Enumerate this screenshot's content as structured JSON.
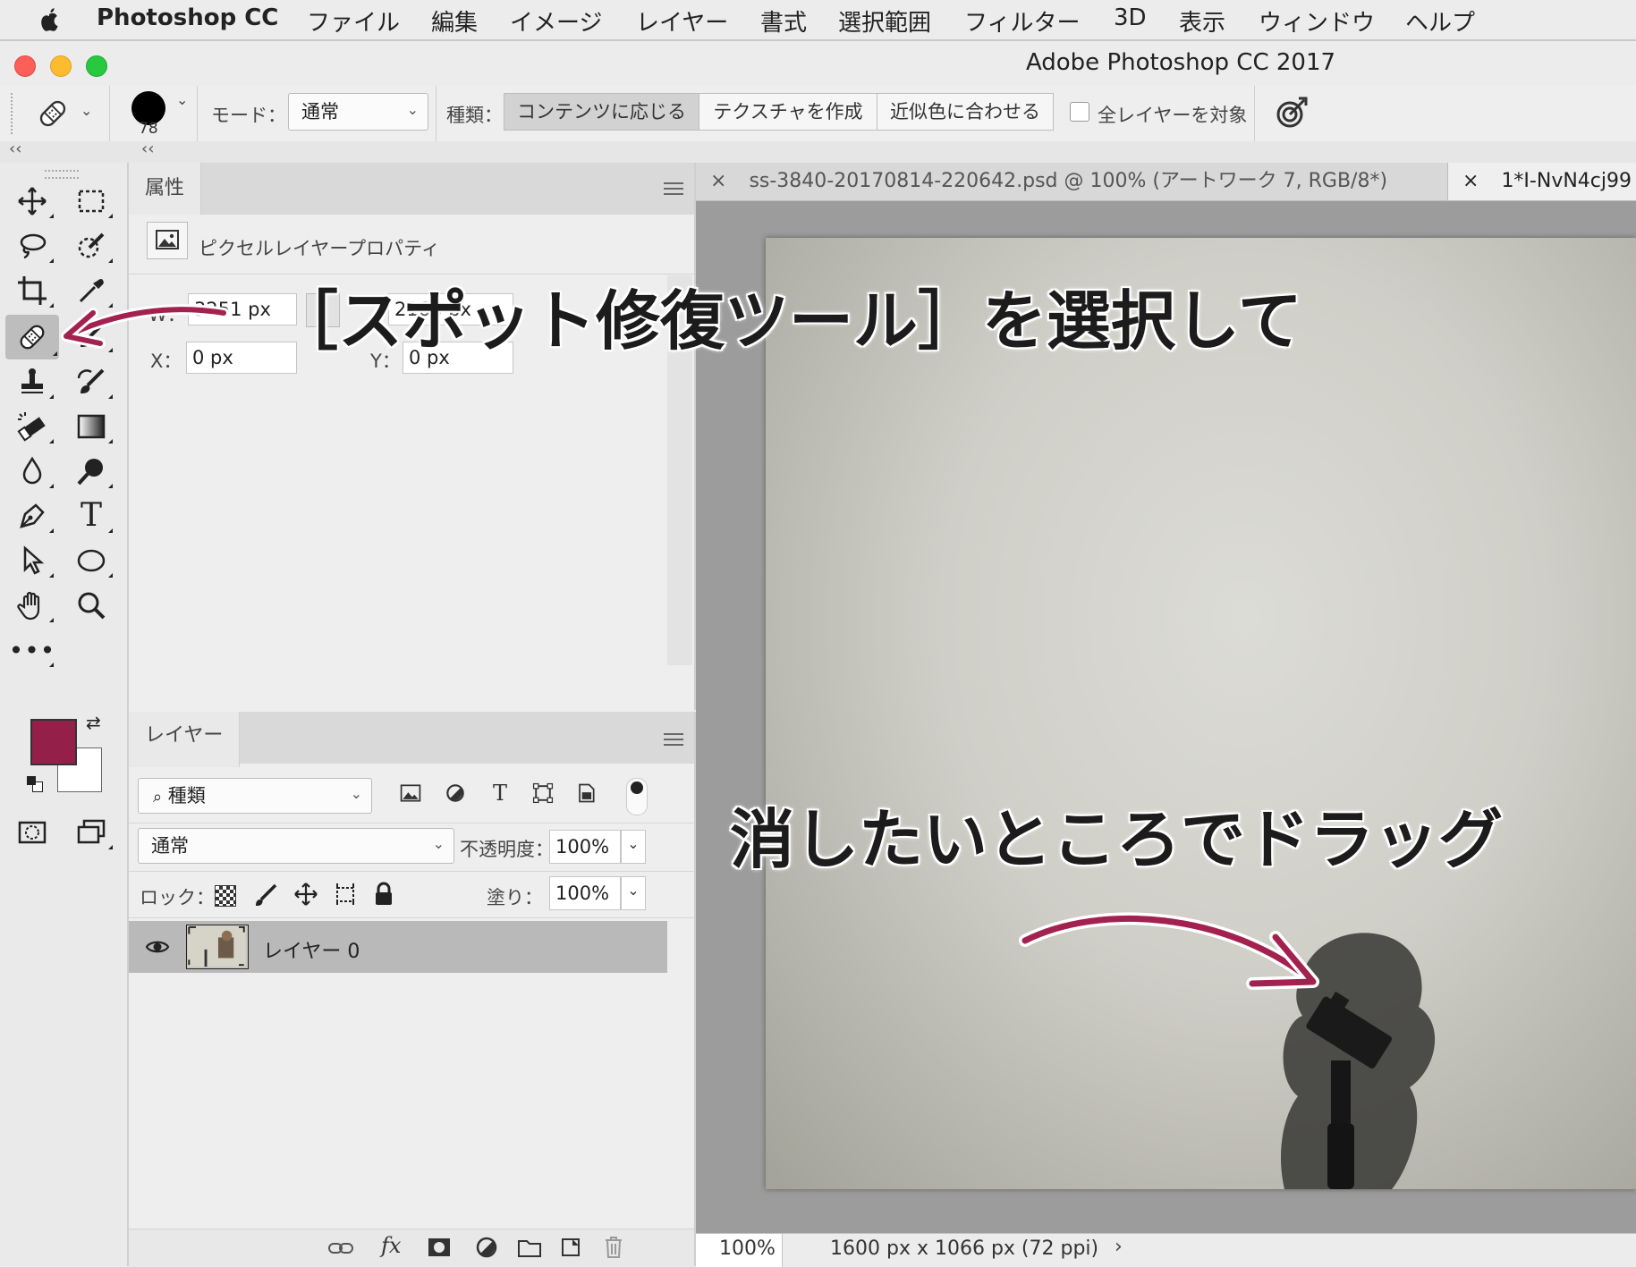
{
  "menubar": {
    "app_name": "Photoshop CC",
    "items": [
      "ファイル",
      "編集",
      "イメージ",
      "レイヤー",
      "書式",
      "選択範囲",
      "フィルター",
      "3D",
      "表示",
      "ウィンドウ",
      "ヘルプ"
    ]
  },
  "window": {
    "title": "Adobe Photoshop CC 2017"
  },
  "options": {
    "brush_size": "78",
    "mode_label": "モード：",
    "mode_value": "通常",
    "type_label": "種類：",
    "type_options": [
      "コンテンツに応じる",
      "テクスチャを作成",
      "近似色に合わせる"
    ],
    "type_selected": "コンテンツに応じる",
    "sample_all_label": "全レイヤーを対象",
    "sample_all_checked": false
  },
  "properties": {
    "tab": "属性",
    "heading": "ピクセルレイヤープロパティ",
    "w_label": "W：",
    "w_value": "3251 px",
    "h_value": "2166 px",
    "x_label": "X：",
    "x_value": "0 px",
    "y_label": "Y：",
    "y_value": "0 px"
  },
  "layers": {
    "tab": "レイヤー",
    "filter_value": "種類",
    "blend_value": "通常",
    "opacity_label": "不透明度：",
    "opacity_value": "100%",
    "lock_label": "ロック：",
    "fill_label": "塗り：",
    "fill_value": "100%",
    "items": [
      {
        "name": "レイヤー 0",
        "visible": true,
        "selected": true
      }
    ],
    "footer_fx": "fx"
  },
  "document": {
    "tabs": [
      {
        "label": "ss-3840-20170814-220642.psd @ 100% (アートワーク 7, RGB/8*)",
        "active": false
      },
      {
        "label": "1*I-NvN4cj99",
        "active": true
      }
    ],
    "zoom": "100%",
    "doc_info": "1600 px x 1066 px (72 ppi)"
  },
  "annotations": {
    "caption_top": "［スポット修復ツール］を選択して",
    "caption_bottom": "消したいところでドラッグ",
    "arrow_color": "#a3214f"
  },
  "colors": {
    "foreground": "#94204a",
    "background": "#ffffff"
  }
}
